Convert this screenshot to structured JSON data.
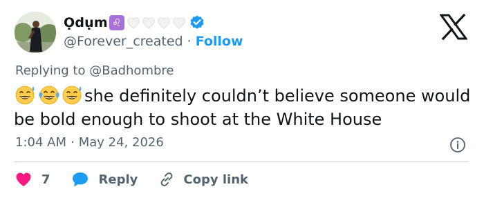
{
  "author": {
    "display_name": "Ọdụm",
    "zodiac_sign": "♌",
    "handle": "@Forever_created",
    "separator": "·",
    "follow_label": "Follow"
  },
  "reply": {
    "prefix": "Replying to",
    "target": "@Badhombre"
  },
  "tweet": {
    "text": "she definitely couldn’t believe someone would be bold enough to shoot at the White House"
  },
  "meta": {
    "time": "1:04 AM",
    "separator": "·",
    "date": "May 24, 2026"
  },
  "actions": {
    "likes_count": "7",
    "reply_label": "Reply",
    "copy_label": "Copy link"
  },
  "colors": {
    "accent": "#1d9bf0",
    "like": "#f91880",
    "secondary_text": "#536471",
    "primary_text": "#0f1419",
    "zodiac_badge": "#a871d9",
    "divider": "#cfd9de"
  },
  "icons": {
    "emojis": [
      "sweat-smile-emoji",
      "tears-of-joy-emoji",
      "sweat-smile-emoji"
    ],
    "hearts": [
      "white-heart-icon",
      "white-heart-icon",
      "white-heart-icon",
      "white-heart-icon"
    ]
  }
}
